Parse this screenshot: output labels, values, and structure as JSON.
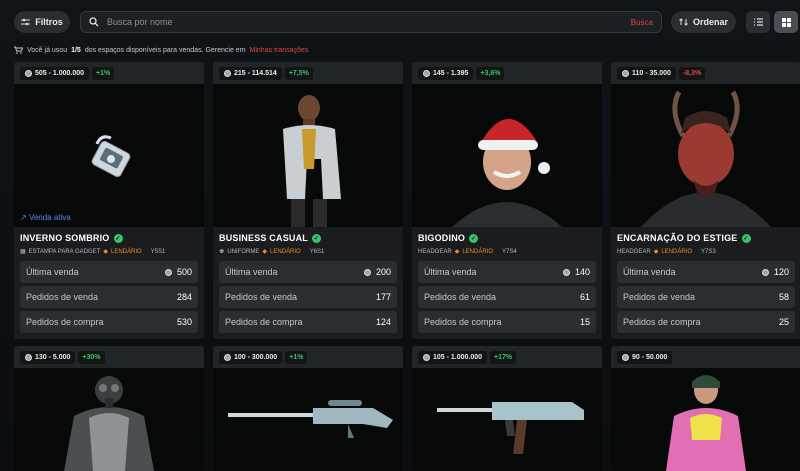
{
  "toolbar": {
    "filters_label": "Filtros",
    "search_placeholder": "Busca por nome",
    "search_button": "Busca",
    "order_label": "Ordenar"
  },
  "notice": {
    "prefix": "Você já usou",
    "used": "1/5",
    "middle": "dos espaços disponíveis para vendas. Gerencie em",
    "link": "Minhas transações"
  },
  "labels": {
    "last_sale": "Última venda",
    "sell_orders": "Pedidos de venda",
    "buy_orders": "Pedidos de compra",
    "active_sale": "Venda ativa"
  },
  "colors": {
    "accent": "#e0453a",
    "up": "#39c46a",
    "down": "#e54848",
    "legendary": "#f08a24"
  },
  "cards": [
    {
      "range": "505 - 1.000.000",
      "change": "+1%",
      "trend": "up",
      "title": "INVERNO SOMBRIO",
      "type": "ESTAMPA PARA GADGET",
      "rarity": "LENDÁRIO",
      "season": "Y5S1",
      "last_sale": "500",
      "sell_orders": "284",
      "buy_orders": "530",
      "active": true,
      "icon": "charm-icon"
    },
    {
      "range": "215 - 114.514",
      "change": "+7,5%",
      "trend": "up",
      "title": "BUSINESS CASUAL",
      "type": "UNIFORME",
      "rarity": "LENDÁRIO",
      "season": "Y6S1",
      "last_sale": "200",
      "sell_orders": "177",
      "buy_orders": "124",
      "active": false,
      "icon": "operator-icon"
    },
    {
      "range": "145 - 1.395",
      "change": "+3,6%",
      "trend": "up",
      "title": "BIGODINO",
      "type": "HEADGEAR",
      "rarity": "LENDÁRIO",
      "season": "Y7S4",
      "last_sale": "140",
      "sell_orders": "61",
      "buy_orders": "15",
      "active": false,
      "icon": "headgear-icon"
    },
    {
      "range": "110 - 35.000",
      "change": "-8,3%",
      "trend": "down",
      "title": "ENCARNAÇÃO DO ESTIGE",
      "type": "HEADGEAR",
      "rarity": "LENDÁRIO",
      "season": "Y7S3",
      "last_sale": "120",
      "sell_orders": "58",
      "buy_orders": "25",
      "active": false,
      "icon": "demon-headgear-icon"
    },
    {
      "range": "130 - 5.000",
      "change": "+30%",
      "trend": "up",
      "icon": "gasmask-uniform-icon"
    },
    {
      "range": "100 - 300.000",
      "change": "+1%",
      "trend": "up",
      "icon": "sniper-rifle-icon"
    },
    {
      "range": "105 - 1.000.000",
      "change": "+17%",
      "trend": "up",
      "icon": "assault-rifle-icon"
    },
    {
      "range": "90 - 50.000",
      "change": "",
      "trend": "up",
      "icon": "pink-uniform-icon"
    }
  ]
}
